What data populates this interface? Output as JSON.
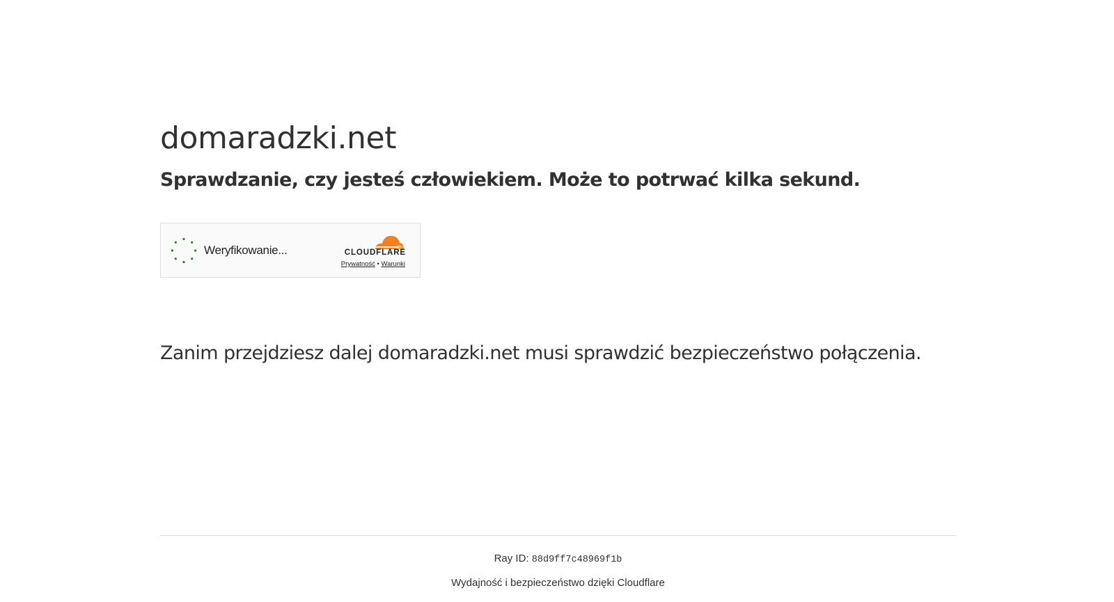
{
  "site": {
    "title": "domaradzki.net",
    "subtitle": "Sprawdzanie, czy jesteś człowiekiem. Może to potrwać kilka sekund."
  },
  "widget": {
    "status_label": "Weryfikowanie...",
    "brand": "CLOUDFLARE",
    "privacy_link": "Prywatność",
    "separator": "•",
    "terms_link": "Warunki",
    "spinner_icon": "loading-spinner-icon",
    "spinner_color": "#2c7c2f",
    "brand_colors": [
      "#f48120",
      "#faad3f"
    ]
  },
  "message": "Zanim przejdziesz dalej domaradzki.net musi sprawdzić bezpieczeństwo połączenia.",
  "footer": {
    "ray_label": "Ray ID:",
    "ray_value": "88d9ff7c48969f1b",
    "powered_by": "Wydajność i bezpieczeństwo dzięki Cloudflare"
  }
}
